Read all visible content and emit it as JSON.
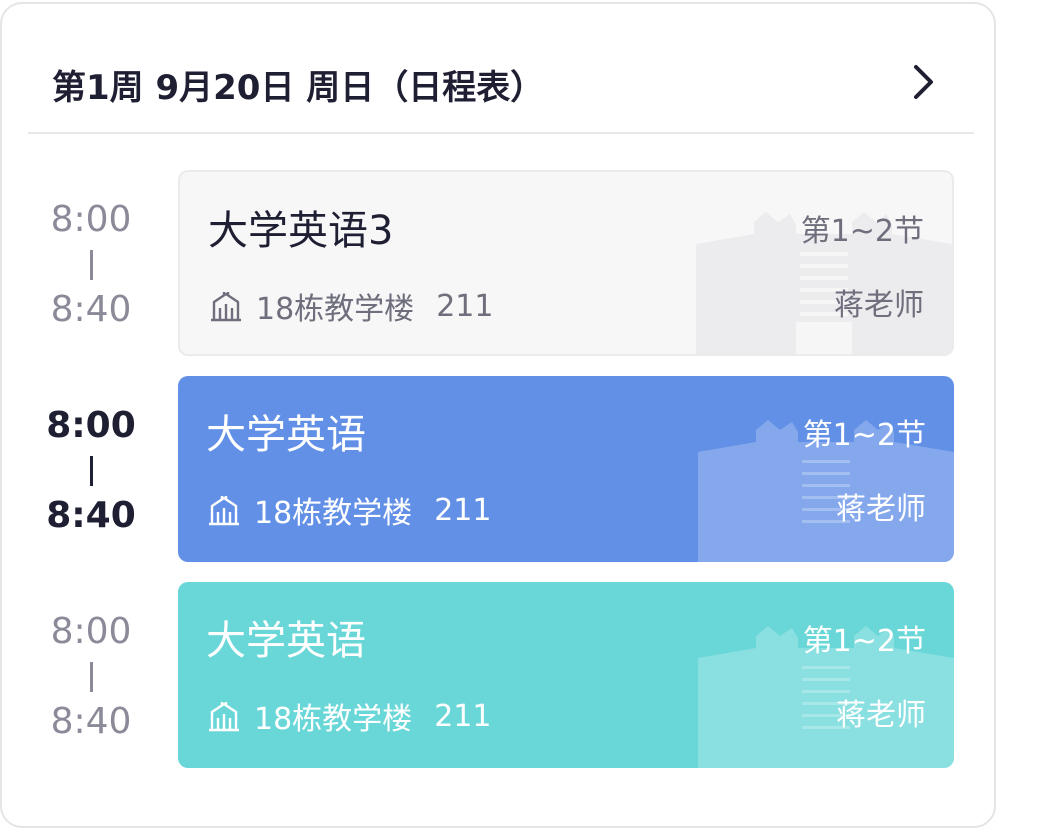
{
  "header": {
    "title": "第1周 9月20日 周日（日程表）"
  },
  "icons": {
    "next": "chevron-right-icon",
    "location": "building-icon",
    "decoration": "campus-building-illustration"
  },
  "colors": {
    "gray_card": "#f7f7f8",
    "blue_card": "#6290e6",
    "teal_card": "#69d7d8",
    "text_dark": "#1f1f33",
    "text_muted": "#8a8a99"
  },
  "courses": [
    {
      "start": "8:00",
      "end": "8:40",
      "name": "大学英语3",
      "building": "18栋教学楼",
      "room": "211",
      "period": "第1~2节",
      "teacher": "蒋老师",
      "theme": "gray",
      "active": false
    },
    {
      "start": "8:00",
      "end": "8:40",
      "name": "大学英语",
      "building": "18栋教学楼",
      "room": "211",
      "period": "第1~2节",
      "teacher": "蒋老师",
      "theme": "blue",
      "active": true
    },
    {
      "start": "8:00",
      "end": "8:40",
      "name": "大学英语",
      "building": "18栋教学楼",
      "room": "211",
      "period": "第1~2节",
      "teacher": "蒋老师",
      "theme": "teal",
      "active": false
    }
  ]
}
